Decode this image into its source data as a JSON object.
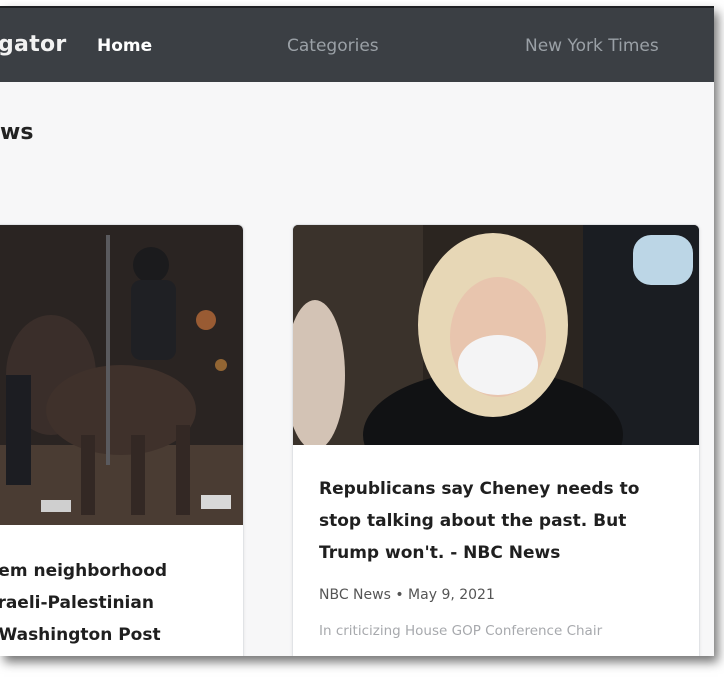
{
  "navbar": {
    "brand": "gator",
    "links": [
      "Home",
      "Categories",
      "New York Times"
    ]
  },
  "section": {
    "title": "ws"
  },
  "cards": [
    {
      "title_lines": "alem neighborhood\n Israeli-Palestinian\ne Washington Post",
      "image": "mounted-police-night-photo"
    },
    {
      "title_lines": "Republicans say Cheney needs to\nstop talking about the past. But\nTrump won't. - NBC News",
      "meta": "NBC News • May 9, 2021",
      "snippet": "In criticizing House GOP Conference Chair",
      "image": "woman-white-mask-photo"
    }
  ],
  "colors": {
    "navbar": "#3b3f44",
    "page_bg": "#f7f7f8"
  }
}
